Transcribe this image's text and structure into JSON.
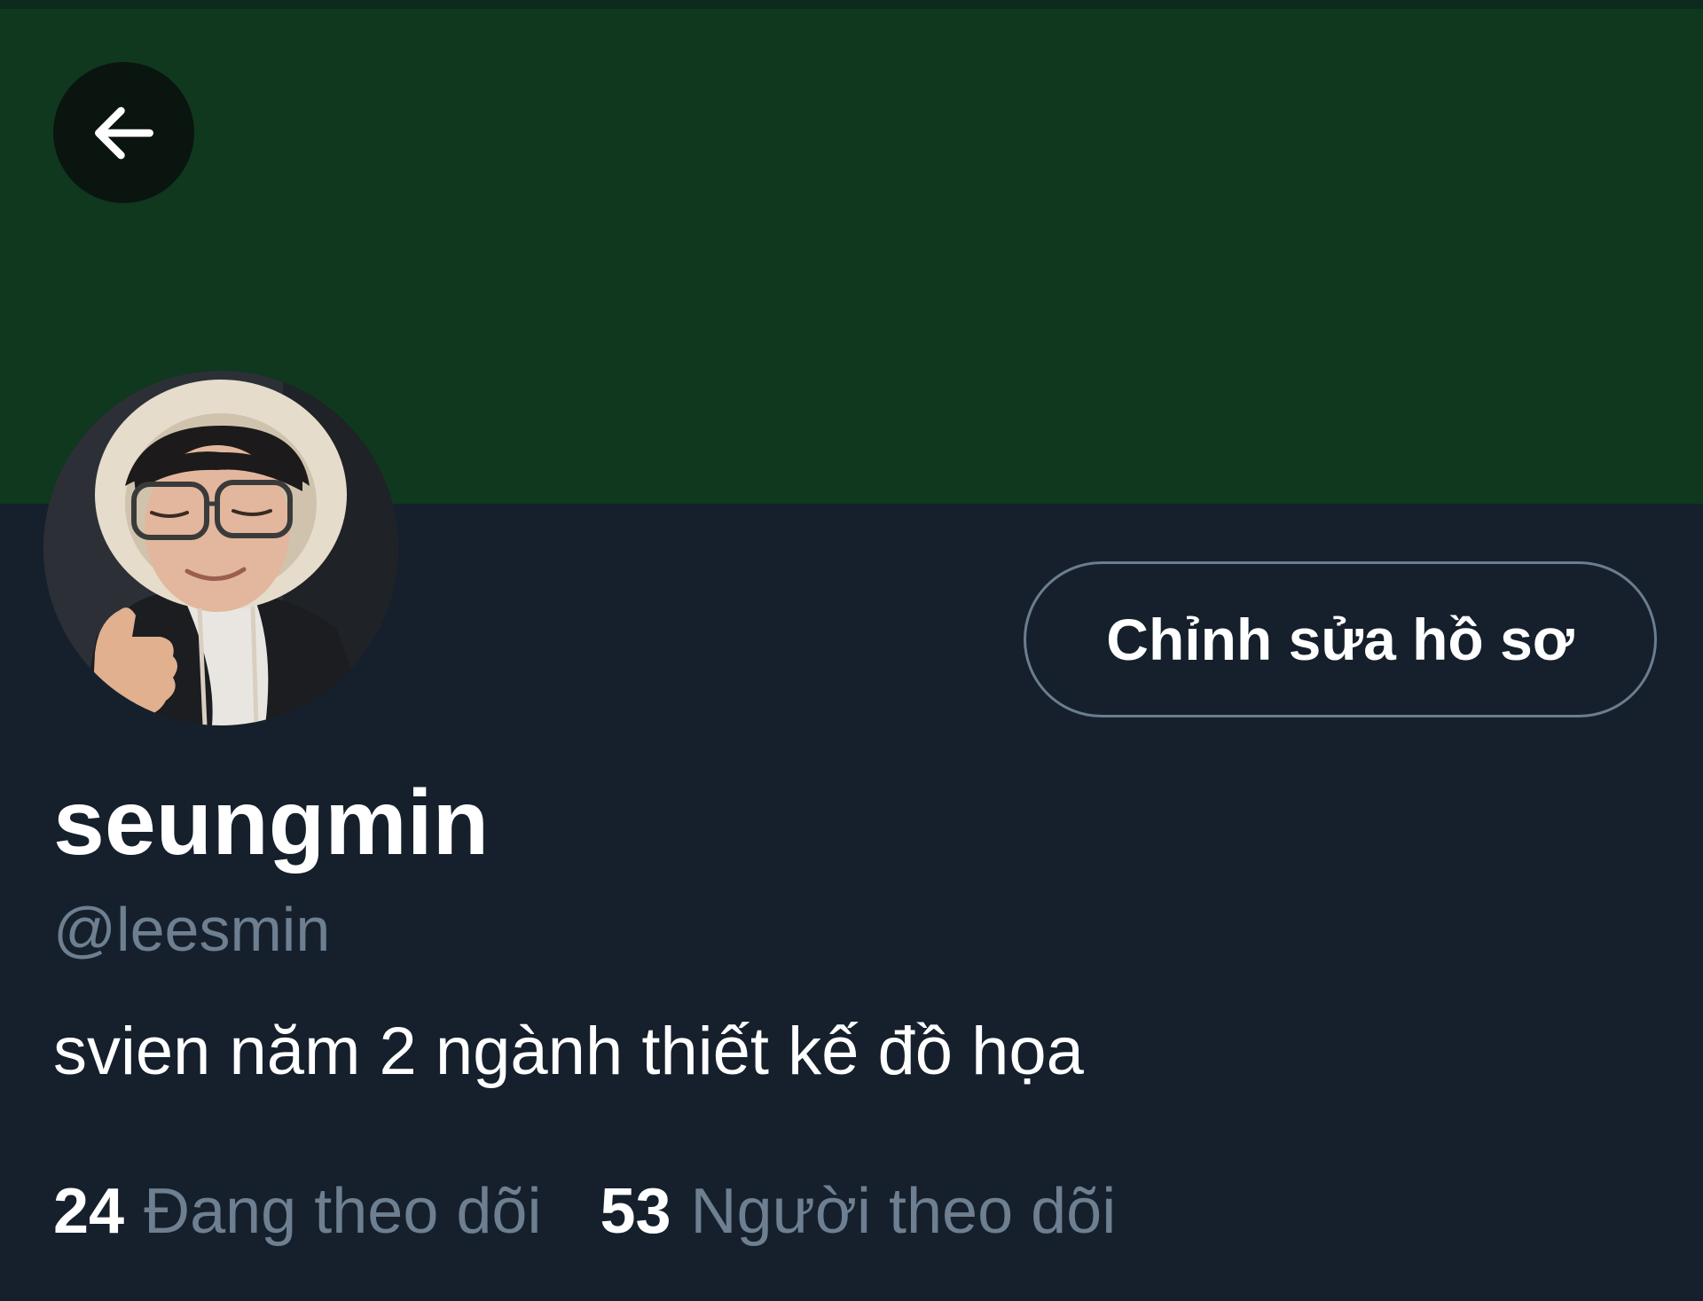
{
  "header": {
    "back_icon": "arrow-left-icon",
    "banner_color": "#0f381f"
  },
  "profile": {
    "avatar_icon": "profile-photo",
    "edit_button_label": "Chỉnh sửa hồ sơ",
    "display_name": "seungmin",
    "handle": "@leesmin",
    "bio": "svien năm 2 ngành thiết kế đồ họa"
  },
  "stats": {
    "following_count": "24",
    "following_label": "Đang theo dõi",
    "followers_count": "53",
    "followers_label": "Người theo dõi"
  },
  "colors": {
    "background": "#16202c",
    "primary_text": "#ffffff",
    "secondary_text": "#6d7f90",
    "button_border": "#6b7d8e"
  }
}
